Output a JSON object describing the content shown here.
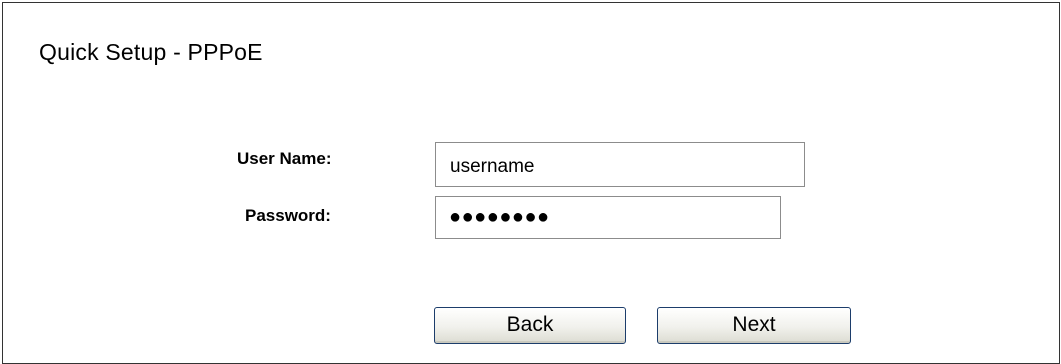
{
  "page": {
    "title": "Quick Setup - PPPoE"
  },
  "form": {
    "username_label": "User Name:",
    "username_value": "username",
    "password_label": "Password:",
    "password_masked": "●●●●●●●●"
  },
  "buttons": {
    "back_label": "Back",
    "next_label": "Next"
  }
}
